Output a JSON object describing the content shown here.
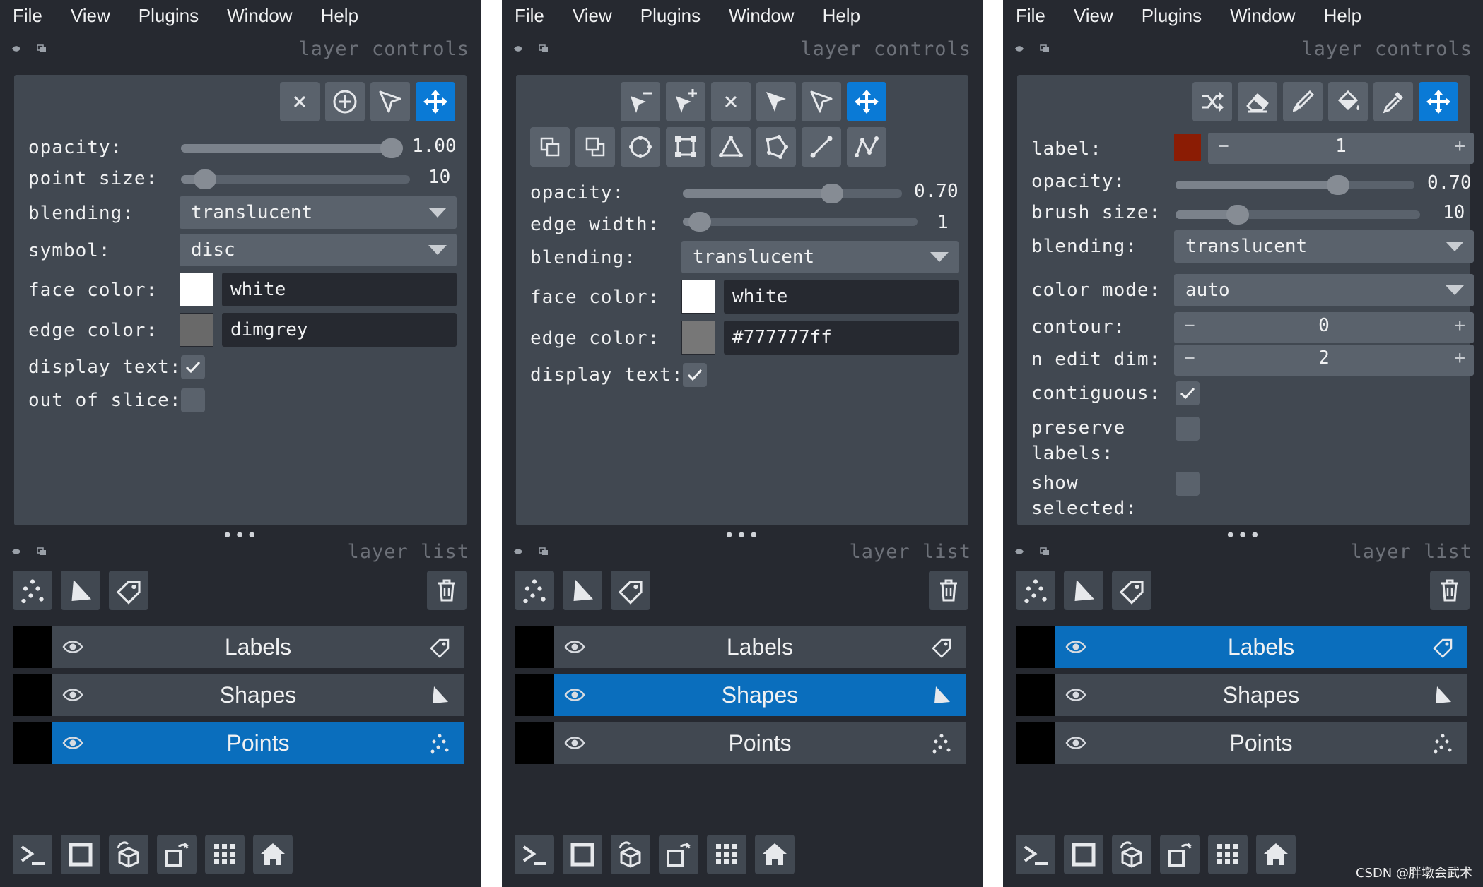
{
  "menu": [
    "File",
    "View",
    "Plugins",
    "Window",
    "Help"
  ],
  "headers": {
    "controls": "layer controls",
    "list": "layer list",
    "dots": "•••"
  },
  "points": {
    "opacity_label": "opacity:",
    "opacity_value": "1.00",
    "opacity_level": 1.0,
    "point_size_label": "point size:",
    "point_size_value": "10",
    "blending_label": "blending:",
    "blending_value": "translucent",
    "symbol_label": "symbol:",
    "symbol_value": "disc",
    "face_label": "face color:",
    "face_value": "white",
    "face_color": "#ffffff",
    "edge_label": "edge color:",
    "edge_value": "dimgrey",
    "edge_color": "#696969",
    "display_label": "display text:",
    "display_checked": true,
    "slice_label": "out of slice:",
    "slice_checked": false
  },
  "shapes": {
    "opacity_label": "opacity:",
    "opacity_value": "0.70",
    "opacity_level": 0.7,
    "edge_width_label": "edge width:",
    "edge_width_value": "1",
    "blending_label": "blending:",
    "blending_value": "translucent",
    "face_label": "face color:",
    "face_value": "white",
    "face_color": "#ffffff",
    "edge_label": "edge color:",
    "edge_value": "#777777ff",
    "edge_color": "#777777",
    "display_label": "display text:",
    "display_checked": true
  },
  "labels": {
    "label_label": "label:",
    "label_value": "1",
    "label_color": "#8b1c04",
    "opacity_label": "opacity:",
    "opacity_value": "0.70",
    "opacity_level": 0.7,
    "brush_label": "brush size:",
    "brush_value": "10",
    "blending_label": "blending:",
    "blending_value": "translucent",
    "color_mode_label": "color mode:",
    "color_mode_value": "auto",
    "contour_label": "contour:",
    "contour_value": "0",
    "ndim_label": "n edit dim:",
    "ndim_value": "2",
    "contiguous_label": "contiguous:",
    "contiguous_checked": true,
    "preserve_label": [
      "preserve",
      "labels:"
    ],
    "preserve_checked": false,
    "show_label": [
      "show",
      "selected:"
    ],
    "show_checked": false
  },
  "layers": [
    "Labels",
    "Shapes",
    "Points"
  ],
  "selected_layer": {
    "p0": "Points",
    "p1": "Shapes",
    "p2": "Labels"
  },
  "colors": {
    "bg": "#262930",
    "panel": "#414851",
    "button": "#5a626c",
    "accent": "#0a7ad6",
    "selected": "#0a6ebd"
  },
  "watermark": "CSDN @胖墩会武术"
}
